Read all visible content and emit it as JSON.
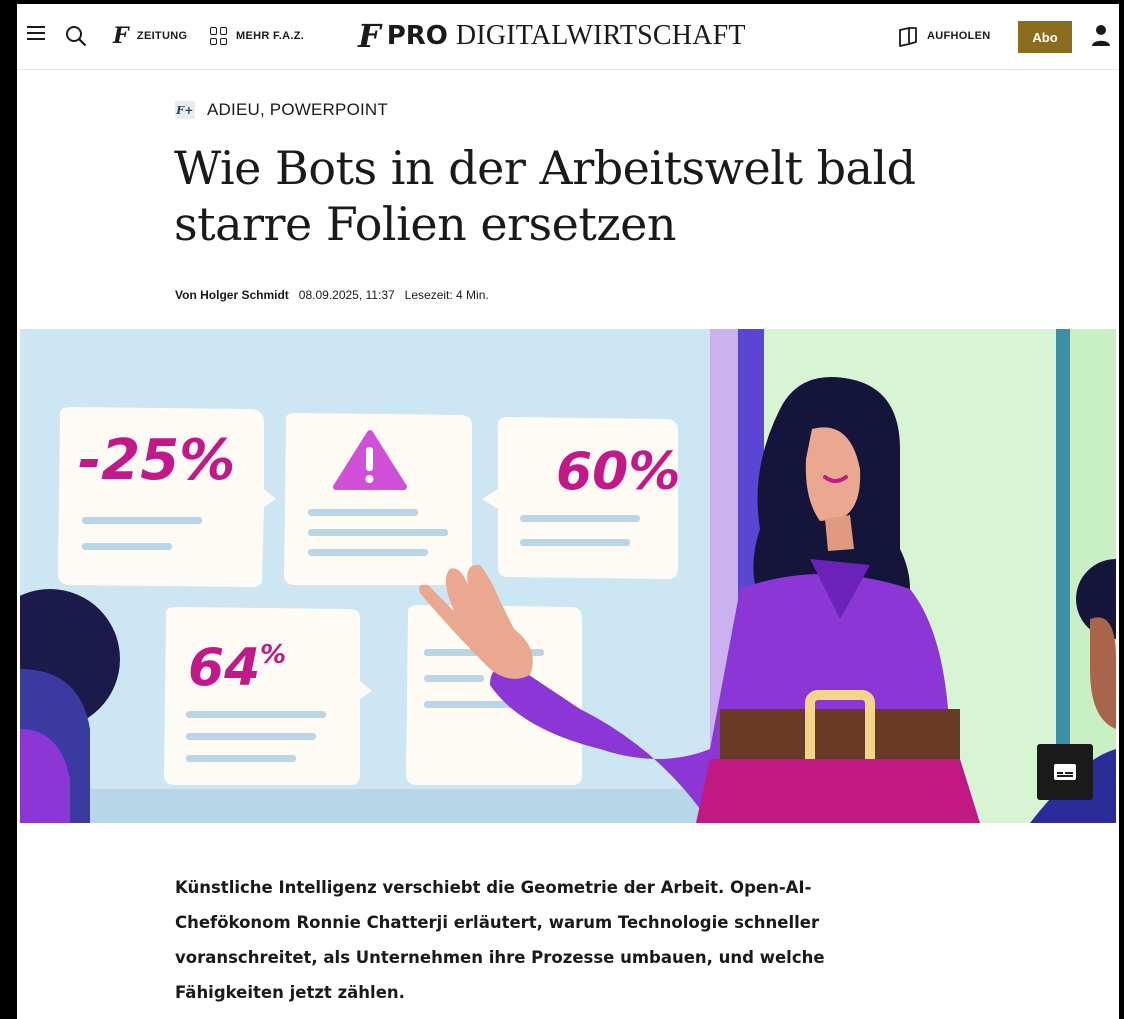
{
  "header": {
    "nav_zeitung": "ZEITUNG",
    "nav_mehr": "MEHR F.A.Z.",
    "logo_mark": "F",
    "logo_pro": "PRO",
    "logo_section": "DIGITALWIRTSCHAFT",
    "aufholen": "AUFHOLEN",
    "abo": "Abo"
  },
  "article": {
    "kicker_badge": "F+",
    "kicker": "ADIEU, POWERPOINT",
    "title": "Wie Bots in der Arbeitswelt bald starre Folien ersetzen",
    "author": "Von Holger Schmidt",
    "date": "08.09.2025, 11:37",
    "reading_time": "Lesezeit: 4 Min.",
    "lead": "Künstliche Intelligenz verschiebt die Geometrie der Arbeit. Open-AI-Chefökonom Ronnie Chatterji erläutert, warum Technologie schneller voranschreitet, als Unternehmen ihre Prozesse umbauen, und welche Fähigkeiten jetzt zählen."
  },
  "illustration": {
    "card_1": "-25%",
    "card_2": "60%",
    "card_3_number": "64",
    "card_3_percent": "%"
  },
  "colors": {
    "abo_button": "#8a6e1e",
    "magenta_text": "#c2188a",
    "purple_shirt": "#8d36d6"
  }
}
